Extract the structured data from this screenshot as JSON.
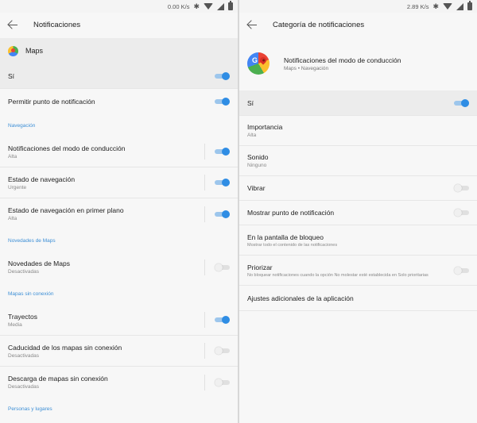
{
  "left": {
    "status": {
      "speed": "0.00 K/s"
    },
    "appbar": {
      "title": "Notificaciones"
    },
    "app_header": {
      "title": "Maps"
    },
    "si_row": {
      "label": "Sí",
      "on": true
    },
    "dot_row": {
      "label": "Permitir punto de notificación",
      "on": true
    },
    "sections": [
      {
        "title": "Navegación",
        "items": [
          {
            "label": "Notificaciones del modo de conducción",
            "sub": "Alta",
            "on": true
          },
          {
            "label": "Estado de navegación",
            "sub": "Urgente",
            "on": true
          },
          {
            "label": "Estado de navegación en primer plano",
            "sub": "Alta",
            "on": true
          }
        ]
      },
      {
        "title": "Novedades de Maps",
        "items": [
          {
            "label": "Novedades de Maps",
            "sub": "Desactivadas",
            "on": false
          }
        ]
      },
      {
        "title": "Mapas sin conexión",
        "items": [
          {
            "label": "Trayectos",
            "sub": "Media",
            "on": true
          },
          {
            "label": "Caducidad de los mapas sin conexión",
            "sub": "Desactivadas",
            "on": false
          },
          {
            "label": "Descarga de mapas sin conexión",
            "sub": "Desactivadas",
            "on": false
          }
        ]
      },
      {
        "title": "Personas y lugares",
        "items": []
      }
    ]
  },
  "right": {
    "status": {
      "speed": "2.89 K/s"
    },
    "appbar": {
      "title": "Categoría de notificaciones"
    },
    "header": {
      "title": "Notificaciones del modo de conducción",
      "subtitle": "Maps • Navegación"
    },
    "si_row": {
      "label": "Sí",
      "on": true
    },
    "importancia": {
      "label": "Importancia",
      "sub": "Alta"
    },
    "sonido": {
      "label": "Sonido",
      "sub": "Ninguno"
    },
    "vibrar": {
      "label": "Vibrar",
      "on": false
    },
    "punto": {
      "label": "Mostrar punto de notificación",
      "on": false
    },
    "bloqueo": {
      "label": "En la pantalla de bloqueo",
      "sub": "Mostrar todo el contenido de las notificaciones"
    },
    "priorizar": {
      "label": "Priorizar",
      "sub": "No bloquear notificaciones cuando la opción No molestar esté establecida en Solo prioritarias",
      "on": false
    },
    "ajustes": {
      "label": "Ajustes adicionales de la aplicación"
    }
  },
  "colors": {
    "accent": "#2f8de4",
    "section": "#3d8fd6"
  }
}
